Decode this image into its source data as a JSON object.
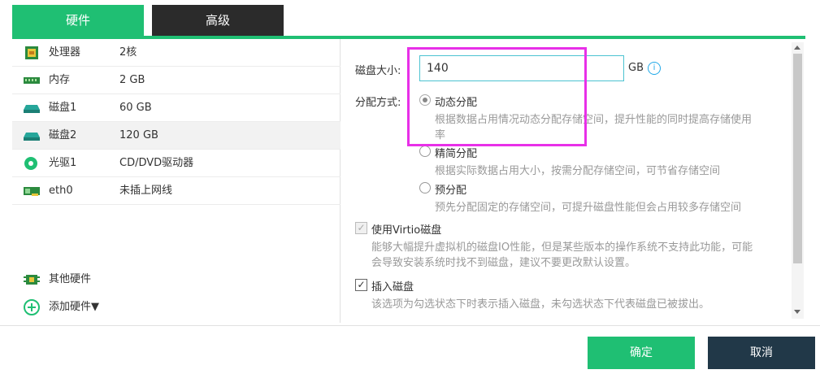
{
  "tabs": [
    {
      "label": "硬件",
      "active": true
    },
    {
      "label": "高级",
      "active": false
    }
  ],
  "hardware": [
    {
      "name": "处理器",
      "value": "2核",
      "icon": "cpu-icon"
    },
    {
      "name": "内存",
      "value": "2 GB",
      "icon": "memory-icon"
    },
    {
      "name": "磁盘1",
      "value": "60 GB",
      "icon": "disk-icon"
    },
    {
      "name": "磁盘2",
      "value": "120 GB",
      "icon": "disk-icon",
      "selected": true
    },
    {
      "name": "光驱1",
      "value": "CD/DVD驱动器",
      "icon": "cdrom-icon"
    },
    {
      "name": "eth0",
      "value": "未插上网线",
      "icon": "network-icon"
    }
  ],
  "other_hardware": "其他硬件",
  "add_hardware": "添加硬件▼",
  "disk_form": {
    "size_label": "磁盘大小:",
    "size_value": "140",
    "size_unit": "GB",
    "alloc_label": "分配方式:",
    "options": [
      {
        "label": "动态分配",
        "desc1": "根据数据占用情况动态分配存储空间，提升性能的同时提高存储使用",
        "desc2": "率",
        "checked": true
      },
      {
        "label": "精简分配",
        "desc1": "根据实际数据占用大小，按需分配存储空间，可节省存储空间",
        "checked": false
      },
      {
        "label": "预分配",
        "desc1": "预先分配固定的存储空间，可提升磁盘性能但会占用较多存储空间",
        "checked": false
      }
    ],
    "virtio_label": "使用Virtio磁盘",
    "virtio_desc1": "能够大幅提升虚拟机的磁盘IO性能，但是某些版本的操作系统不支持此功能，可能",
    "virtio_desc2": "会导致安装系统时找不到磁盘，建议不要更改默认设置。",
    "insert_label": "插入磁盘",
    "insert_desc": "该选项为勾选状态下时表示插入磁盘，未勾选状态下代表磁盘已被拔出。"
  },
  "buttons": {
    "ok": "确定",
    "cancel": "取消"
  },
  "colors": {
    "accent": "#1fbf73",
    "dark": "#2b2b2b",
    "cancel": "#213848",
    "highlight": "#e830e8"
  }
}
